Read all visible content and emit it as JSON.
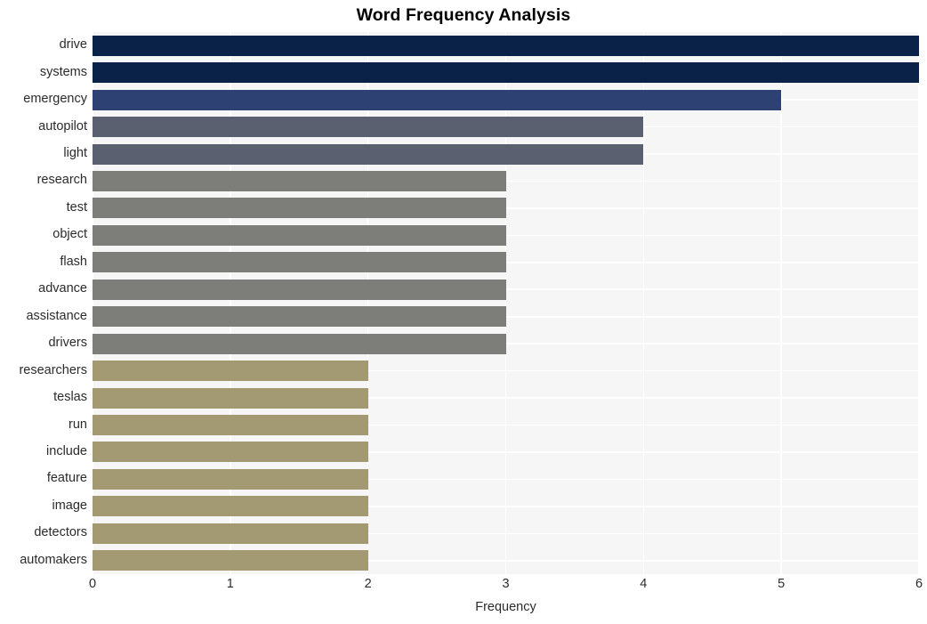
{
  "chart_data": {
    "type": "bar",
    "orientation": "horizontal",
    "title": "Word Frequency Analysis",
    "xlabel": "Frequency",
    "ylabel": "",
    "xlim": [
      0,
      6
    ],
    "xticks": [
      0,
      1,
      2,
      3,
      4,
      5,
      6
    ],
    "xtick_labels": [
      "0",
      "1",
      "2",
      "3",
      "4",
      "5",
      "6"
    ],
    "grid": true,
    "legend": "none",
    "categories": [
      "drive",
      "systems",
      "emergency",
      "autopilot",
      "light",
      "research",
      "test",
      "object",
      "flash",
      "advance",
      "assistance",
      "drivers",
      "researchers",
      "teslas",
      "run",
      "include",
      "feature",
      "image",
      "detectors",
      "automakers"
    ],
    "values": [
      6,
      6,
      5,
      4,
      4,
      3,
      3,
      3,
      3,
      3,
      3,
      3,
      2,
      2,
      2,
      2,
      2,
      2,
      2,
      2
    ],
    "bar_colors": [
      "#0a2248",
      "#0a2248",
      "#2d4272",
      "#5a6070",
      "#5a6070",
      "#7d7d79",
      "#7d7d79",
      "#7d7d79",
      "#7d7d79",
      "#7d7d79",
      "#7d7d79",
      "#7d7d79",
      "#a39a74",
      "#a39a74",
      "#a39a74",
      "#a39a74",
      "#a39a74",
      "#a39a74",
      "#a39a74",
      "#a39a74"
    ],
    "plot_background": "#f6f6f7",
    "figure_background": "#ffffff",
    "grid_color": "#ffffff"
  }
}
